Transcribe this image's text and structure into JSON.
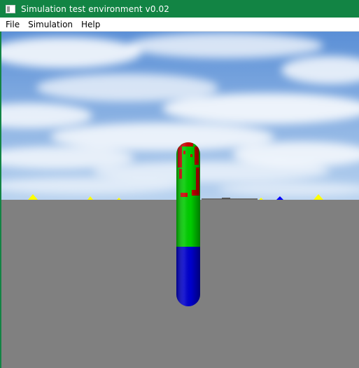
{
  "window": {
    "title": "Simulation test environment v0.02",
    "icon": "app-window-icon",
    "titlebar_color": "#128444"
  },
  "menubar": {
    "items": [
      {
        "label": "File"
      },
      {
        "label": "Simulation"
      },
      {
        "label": "Help"
      }
    ]
  },
  "scene": {
    "sky_colors": [
      "#5a8fd6",
      "#b8d2ef"
    ],
    "ground_color": "#808080",
    "capsule_colors": {
      "upper": "#00cc00",
      "lower": "#0000cc",
      "marks": "#cc0000"
    },
    "markers": [
      {
        "color": "#ffff00",
        "shape": "cone"
      },
      {
        "color": "#ffff00",
        "shape": "cone"
      },
      {
        "color": "#ffff00",
        "shape": "cone"
      },
      {
        "color": "#ffff00",
        "shape": "cone"
      },
      {
        "color": "#0000ff",
        "shape": "cone"
      },
      {
        "color": "#ffff00",
        "shape": "cone"
      }
    ]
  }
}
